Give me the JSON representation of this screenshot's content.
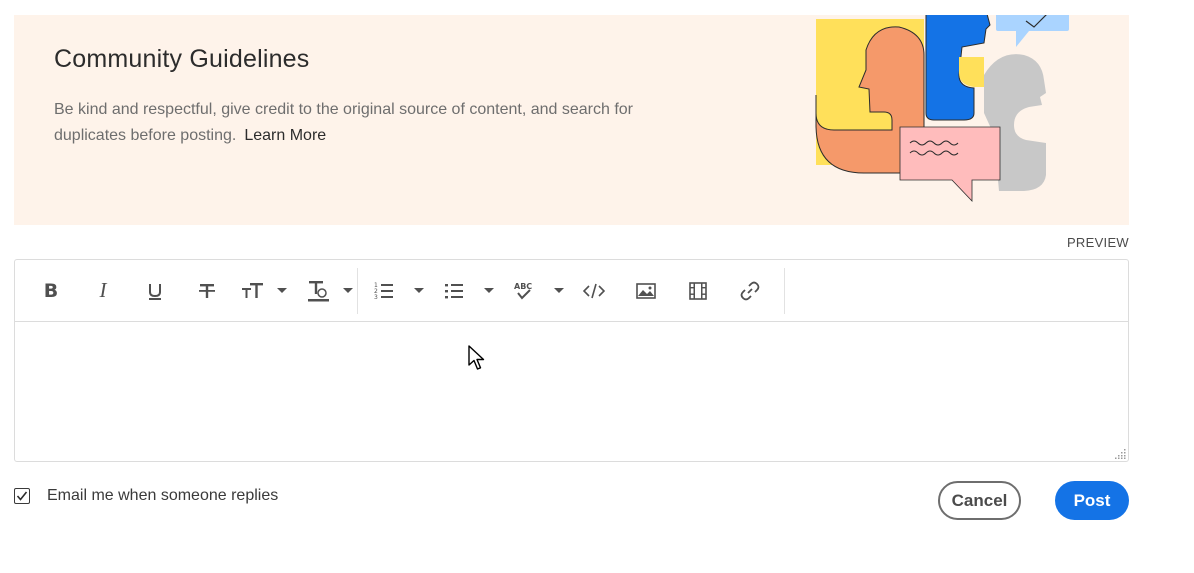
{
  "guidelines": {
    "title": "Community Guidelines",
    "body": "Be kind and respectful, give credit to the original source of content, and search for duplicates before posting.",
    "learn_more": "Learn More"
  },
  "editor": {
    "preview_label": "PREVIEW",
    "body_text": "",
    "toolbar": [
      {
        "name": "bold-icon",
        "label": "B"
      },
      {
        "name": "italic-icon",
        "label": "I"
      },
      {
        "name": "underline-icon"
      },
      {
        "name": "strikethrough-icon"
      },
      {
        "name": "text-size-icon"
      },
      {
        "name": "text-color-icon"
      },
      {
        "name": "numbered-list-icon"
      },
      {
        "name": "bulleted-list-icon"
      },
      {
        "name": "spellcheck-icon"
      },
      {
        "name": "code-icon"
      },
      {
        "name": "image-icon"
      },
      {
        "name": "video-icon"
      },
      {
        "name": "link-icon"
      }
    ]
  },
  "options": {
    "email_label": "Email me when someone replies",
    "email_checked": true
  },
  "actions": {
    "cancel_label": "Cancel",
    "post_label": "Post"
  },
  "colors": {
    "banner_bg": "#fef3ea",
    "post_button": "#1473e6",
    "illustration_yellow": "#ffe05a",
    "illustration_orange": "#f5996a",
    "illustration_blue": "#1473e6",
    "illustration_gray": "#c8c8c8",
    "illustration_pink": "#ffbcbc",
    "illustration_light_blue": "#aad4ff"
  }
}
